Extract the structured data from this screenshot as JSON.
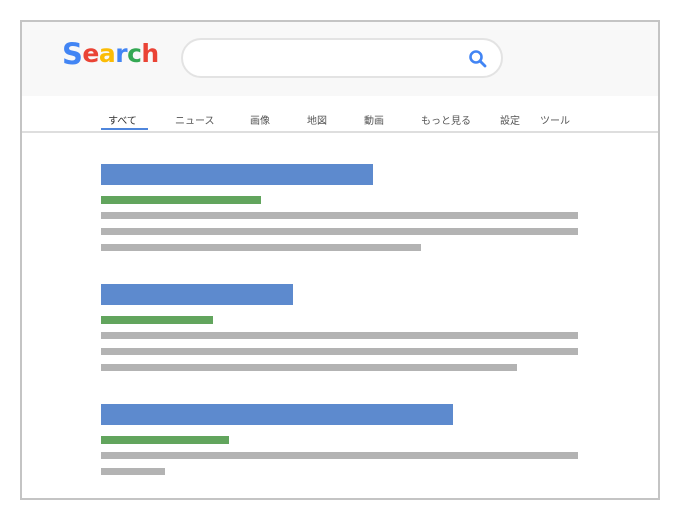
{
  "logo": {
    "text": "Search",
    "letters": [
      {
        "char": "S",
        "color": "#4285f4"
      },
      {
        "char": "e",
        "color": "#ea4335"
      },
      {
        "char": "a",
        "color": "#fbbc05"
      },
      {
        "char": "r",
        "color": "#4285f4"
      },
      {
        "char": "c",
        "color": "#34a853"
      },
      {
        "char": "h",
        "color": "#ea4335"
      }
    ]
  },
  "search": {
    "value": "",
    "placeholder": "",
    "icon": "search-icon",
    "icon_color": "#4285f4"
  },
  "nav": {
    "tabs": [
      {
        "label": "すべて",
        "active": true
      },
      {
        "label": "ニュース",
        "active": false
      },
      {
        "label": "画像",
        "active": false
      },
      {
        "label": "地図",
        "active": false
      },
      {
        "label": "動画",
        "active": false
      },
      {
        "label": "もっと見る",
        "active": false
      },
      {
        "label": "設定",
        "active": false
      },
      {
        "label": "ツール",
        "active": false
      }
    ],
    "active_color": "#4f86dc"
  },
  "results": [
    {
      "title_placeholder": "title",
      "url_placeholder": "url",
      "snippet_lines": 3,
      "title_fraction": 0.57,
      "url_fraction": 0.335,
      "last_line_fraction": 0.67
    },
    {
      "title_placeholder": "title",
      "url_placeholder": "url",
      "snippet_lines": 3,
      "title_fraction": 0.4,
      "url_fraction": 0.235,
      "last_line_fraction": 0.87
    },
    {
      "title_placeholder": "title",
      "url_placeholder": "url",
      "snippet_lines": 2,
      "title_fraction": 0.74,
      "url_fraction": 0.27,
      "last_line_fraction": 0.135
    }
  ],
  "colors": {
    "title_bar": "#5d8ace",
    "url_bar": "#62a55d",
    "snippet_bar": "#b3b3b3",
    "header_bg": "#f8f8f8"
  }
}
